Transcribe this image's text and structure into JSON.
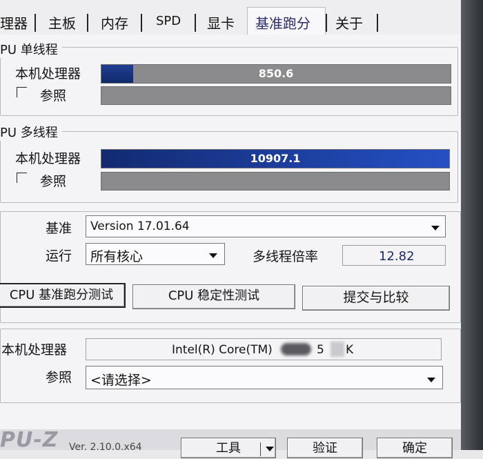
{
  "tabs": [
    "理器",
    "主板",
    "内存",
    "SPD",
    "显卡",
    "基准跑分",
    "关于"
  ],
  "single_thread": {
    "title": "PU 单线程",
    "row_this": "本机处理器",
    "row_ref": "参照",
    "score": "850.6",
    "fill_fraction": 0.09
  },
  "multi_thread": {
    "title": "PU 多线程",
    "row_this": "本机处理器",
    "row_ref": "参照",
    "score": "10907.1",
    "fill_fraction": 1.0
  },
  "settings": {
    "benchmark_label": "基准",
    "benchmark_value": "Version 17.01.64",
    "run_label": "运行",
    "run_value": "所有核心",
    "ratio_label": "多线程倍率",
    "ratio_value": "12.82"
  },
  "buttons": {
    "bench": "CPU 基准跑分测试",
    "stability": "CPU 稳定性测试",
    "submit": "提交与比较"
  },
  "processor": {
    "this_label": "本机处理器",
    "this_value": "Intel(R) Core(TM)",
    "this_value_tail_1": "5",
    "this_value_tail_2": "K",
    "ref_label": "参照",
    "ref_placeholder": "<请选择>"
  },
  "footer": {
    "logo": "PU-Z",
    "version": "Ver. 2.10.0.x64",
    "tools": "工具",
    "validate": "验证",
    "ok": "确定"
  },
  "colors": {
    "accent_bar": "#1f3f92",
    "bar_track": "#8b8b8d"
  }
}
